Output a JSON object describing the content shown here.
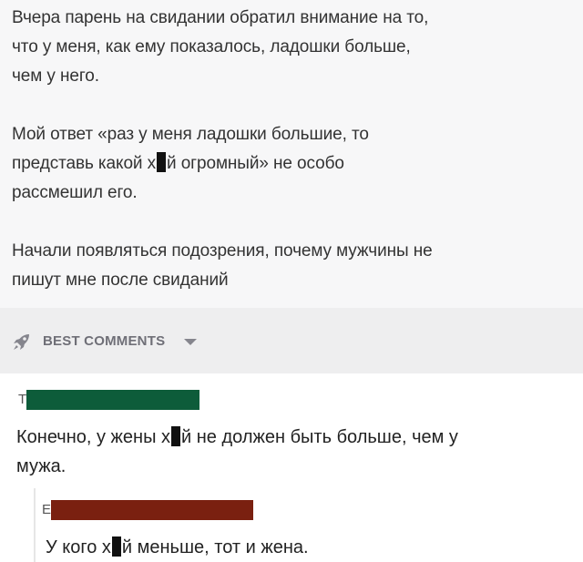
{
  "post": {
    "paragraphs": [
      [
        "Вчера парень на свидании обратил внимание на то,",
        "что у меня, как ему показалось, ладошки больше,",
        "чем у него."
      ],
      [
        "Мой ответ «раз у меня ладошки большие, то",
        "представь какой х",
        "й огромный» не особо",
        "рассмешил его."
      ],
      [
        "Начали появляться подозрения, почему мужчины не",
        "пишут мне после свиданий"
      ]
    ]
  },
  "comments_header": {
    "label": "BEST COMMENTS"
  },
  "comments": [
    {
      "user_initial": "Т",
      "redact_color": "#0d5c3a",
      "text_before": "Конечно, у жены х",
      "text_after": "й не должен быть больше, чем у",
      "text_line2": "мужа."
    },
    {
      "user_initial": "Е",
      "redact_color": "#7a2010",
      "text_before": "У кого х",
      "text_after": "й меньше, тот и жена."
    }
  ]
}
